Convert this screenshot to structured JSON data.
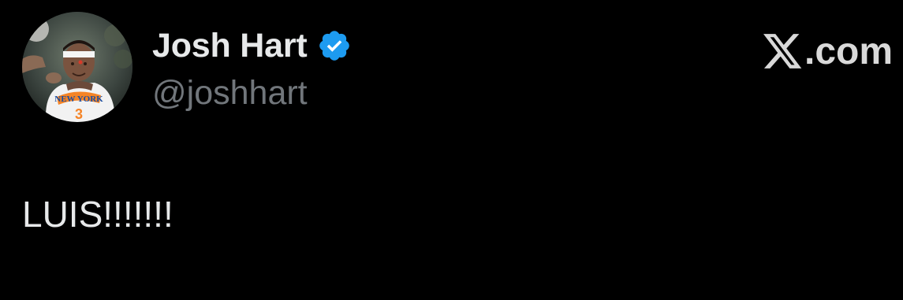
{
  "author": {
    "display_name": "Josh Hart",
    "handle": "@joshhart",
    "verified": true,
    "verified_color": "#1d9bf0",
    "avatar_icon": "profile-photo-knicks-player"
  },
  "brand": {
    "label": ".com",
    "icon": "x-logo-icon"
  },
  "tweet": {
    "text": "LUIS!!!!!!!"
  },
  "theme": {
    "background": "#000000",
    "text_primary": "#e7e9ea",
    "text_secondary": "#71767b"
  }
}
